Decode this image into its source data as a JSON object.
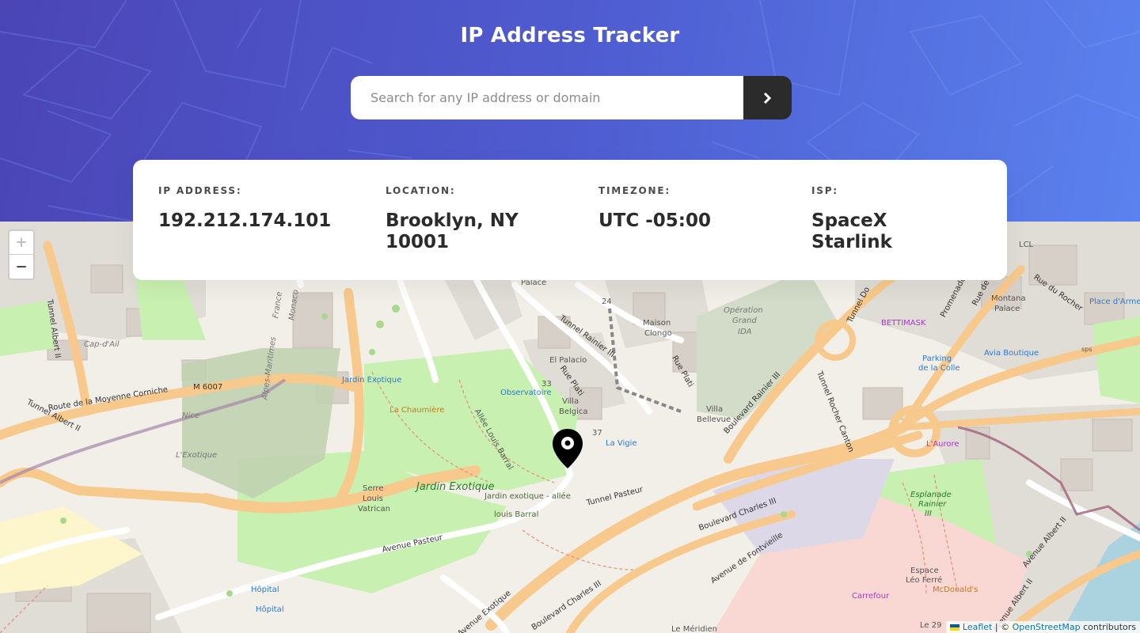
{
  "app": {
    "title": "IP Address Tracker"
  },
  "search": {
    "placeholder": "Search for any IP address or domain",
    "value": "",
    "submit_icon": "chevron-right-icon"
  },
  "info": {
    "ip_label": "IP ADDRESS:",
    "ip_value": "192.212.174.101",
    "location_label": "LOCATION:",
    "location_value_line1": "Brooklyn, NY",
    "location_value_line2": "10001",
    "timezone_label": "TIMEZONE:",
    "timezone_value": "UTC -05:00",
    "isp_label": "ISP:",
    "isp_value_line1": "SpaceX",
    "isp_value_line2": "Starlink"
  },
  "map": {
    "zoom_in": "+",
    "zoom_out": "−",
    "attribution_leaflet": "Leaflet",
    "attribution_sep": " | © ",
    "attribution_osm": "OpenStreetMap",
    "attribution_suffix": " contributors",
    "labels": {
      "route_moyenne_corniche": "Route de la Moyenne Corniche",
      "m6007": "M 6007",
      "tunnel_albert_ii": "Tunnel Albert II",
      "tunnel_albert_ii_2": "Tunnel Albert II",
      "nice": "Nice",
      "lexotique": "L'Exotique",
      "alpes_maritimes": "Alpes-Maritimes",
      "france": "France",
      "monaco": "Monaco",
      "cap_dail": "Cap-d'Ail",
      "jardin_exotique_bus": "Jardin Exotique",
      "la_chaumiere": "La Chaumière",
      "observatoire": "Observatoire",
      "allee_louis_barral": "Allée Louis Barral",
      "jardin_exotique": "Jardin Exotique",
      "jardin_exotique_allee": "Jardin exotique - allée",
      "louis_barral": "louis Barral",
      "serre": "Serre",
      "louis": "Louis",
      "vatrican": "Vatrican",
      "avenue_pasteur": "Avenue Pasteur",
      "hopital_1": "Hôpital",
      "hopital_2": "Hôpital",
      "el_palacio": "El Palacio",
      "rue_plati": "Rue Plati",
      "rue_plati_2": "Rue Plati",
      "villa_belgica": "Villa",
      "villa_belgica_2": "Belgica",
      "la_vigie": "La Vigie",
      "palace": "Palace",
      "maison_clongo": "Maison",
      "maison_clongo_2": "Clongo",
      "tunnel_rainier_iii": "Tunnel Rainier III",
      "operation_grand_ida": "Opération",
      "operation_grand_ida_2": "Grand",
      "operation_grand_ida_3": "IDA",
      "villa_bellevue": "Villa",
      "villa_bellevue_2": "Bellevue",
      "boulevard_rainier_iii": "Boulevard Rainier III",
      "tunnel_rocher_canton": "Tunnel Rocher Canton",
      "tunnel_pasteur": "Tunnel Pasteur",
      "boulevard_charles_iii": "Boulevard Charles III",
      "boulevard_charles_iii_2": "Boulevard Charles III",
      "avenue_de_fontvieille": "Avenue de Fontvieille",
      "bettimask": "BETTIMASK",
      "parking_colle": "Parking",
      "parking_colle_2": "de la Colle",
      "avia_boutique": "Avia Boutique",
      "montana_palace": "Montana",
      "montana_palace_2": "Palace",
      "rue_du_rocher": "Rue du Rocher",
      "place_armes": "Place d'Armes",
      "laurore": "L'Aurore",
      "esplanade_rainier": "Esplanade",
      "esplanade_rainier_2": "Rainier",
      "esplanade_rainier_3": "III",
      "espace_leo_ferre": "Espace",
      "espace_leo_ferre_2": "Léo Ferré",
      "mcdonalds": "McDonald's",
      "carrefour": "Carrefour",
      "avenue_albert_ii": "Avenue Albert II",
      "avenue_albert_ii_2": "Avenue Albert II",
      "le_meridien": "Le Méridien",
      "lcl": "LCL",
      "sps": "sps",
      "le29": "Le 29",
      "n33": "33",
      "n37": "37",
      "n24": "24",
      "promenade": "Promenade",
      "rue_de": "Rue de",
      "tunnel_do": "Tunnel Do",
      "avenue_exotique": "Avenue Exotique"
    }
  },
  "colors": {
    "header_start": "#4b45b6",
    "header_end": "#5b82ee",
    "button": "#2b2b2b",
    "road_major": "#f7c98c",
    "park": "#c8f0b0",
    "hospital": "#f9d7d2"
  }
}
